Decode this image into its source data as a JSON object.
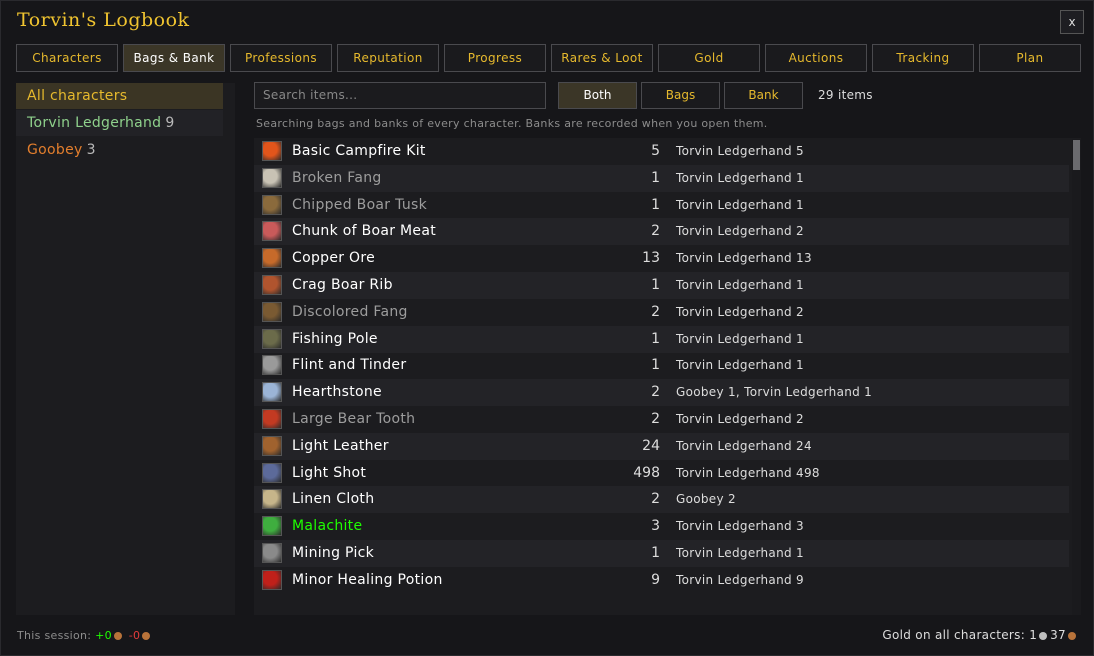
{
  "window": {
    "title": "Torvin's Logbook",
    "close_label": "x"
  },
  "tabs": [
    {
      "label": "Characters"
    },
    {
      "label": "Bags & Bank",
      "active": true
    },
    {
      "label": "Professions"
    },
    {
      "label": "Reputation"
    },
    {
      "label": "Progress"
    },
    {
      "label": "Rares & Loot"
    },
    {
      "label": "Gold"
    },
    {
      "label": "Auctions"
    },
    {
      "label": "Tracking"
    },
    {
      "label": "Plan"
    }
  ],
  "sidebar": {
    "items": [
      {
        "label": "All characters",
        "count": ""
      },
      {
        "label": "Torvin Ledgerhand",
        "count": "9"
      },
      {
        "label": "Goobey",
        "count": "3"
      }
    ]
  },
  "search": {
    "placeholder": "Search items..."
  },
  "filters": {
    "both": "Both",
    "bags": "Bags",
    "bank": "Bank",
    "active": "Both"
  },
  "items_count": "29 items",
  "hint": "Searching bags and banks of every character. Banks are recorded when you open them.",
  "items": [
    {
      "name": "Basic Campfire Kit",
      "qty": "5",
      "owners": "Torvin Ledgerhand 5",
      "quality": "white",
      "icon": "campfire-icon",
      "color": "#e2551b"
    },
    {
      "name": "Broken Fang",
      "qty": "1",
      "owners": "Torvin Ledgerhand 1",
      "quality": "gray",
      "icon": "fang-icon",
      "color": "#c8c2b4"
    },
    {
      "name": "Chipped Boar Tusk",
      "qty": "1",
      "owners": "Torvin Ledgerhand 1",
      "quality": "gray",
      "icon": "tusk-icon",
      "color": "#8a6a3c"
    },
    {
      "name": "Chunk of Boar Meat",
      "qty": "2",
      "owners": "Torvin Ledgerhand 2",
      "quality": "white",
      "icon": "meat-icon",
      "color": "#c95a5a"
    },
    {
      "name": "Copper Ore",
      "qty": "13",
      "owners": "Torvin Ledgerhand 13",
      "quality": "white",
      "icon": "ore-icon",
      "color": "#c66a2a"
    },
    {
      "name": "Crag Boar Rib",
      "qty": "1",
      "owners": "Torvin Ledgerhand 1",
      "quality": "white",
      "icon": "rib-icon",
      "color": "#b0542e"
    },
    {
      "name": "Discolored Fang",
      "qty": "2",
      "owners": "Torvin Ledgerhand 2",
      "quality": "gray",
      "icon": "fang-icon",
      "color": "#7a5a32"
    },
    {
      "name": "Fishing Pole",
      "qty": "1",
      "owners": "Torvin Ledgerhand 1",
      "quality": "white",
      "icon": "fishing-pole-icon",
      "color": "#6b6b4a"
    },
    {
      "name": "Flint and Tinder",
      "qty": "1",
      "owners": "Torvin Ledgerhand 1",
      "quality": "white",
      "icon": "flint-icon",
      "color": "#9a9a9a"
    },
    {
      "name": "Hearthstone",
      "qty": "2",
      "owners": "Goobey 1, Torvin Ledgerhand 1",
      "quality": "white",
      "icon": "hearthstone-icon",
      "color": "#9bb4d6"
    },
    {
      "name": "Large Bear Tooth",
      "qty": "2",
      "owners": "Torvin Ledgerhand 2",
      "quality": "gray",
      "icon": "tooth-icon",
      "color": "#c33a22"
    },
    {
      "name": "Light Leather",
      "qty": "24",
      "owners": "Torvin Ledgerhand 24",
      "quality": "white",
      "icon": "leather-icon",
      "color": "#a0622e"
    },
    {
      "name": "Light Shot",
      "qty": "498",
      "owners": "Torvin Ledgerhand 498",
      "quality": "white",
      "icon": "shot-icon",
      "color": "#5c6a9a"
    },
    {
      "name": "Linen Cloth",
      "qty": "2",
      "owners": "Goobey 2",
      "quality": "white",
      "icon": "cloth-icon",
      "color": "#c6b58a"
    },
    {
      "name": "Malachite",
      "qty": "3",
      "owners": "Torvin Ledgerhand 3",
      "quality": "green",
      "icon": "gem-icon",
      "color": "#3fae3f"
    },
    {
      "name": "Mining Pick",
      "qty": "1",
      "owners": "Torvin Ledgerhand 1",
      "quality": "white",
      "icon": "pick-icon",
      "color": "#8a8a8a"
    },
    {
      "name": "Minor Healing Potion",
      "qty": "9",
      "owners": "Torvin Ledgerhand 9",
      "quality": "white",
      "icon": "potion-icon",
      "color": "#c0201a"
    }
  ],
  "footer": {
    "session_label": "This session:",
    "session_plus": "+0",
    "session_minus": "-0",
    "gold_label": "Gold on all characters:",
    "gold_silver": "1",
    "gold_copper": "37"
  }
}
